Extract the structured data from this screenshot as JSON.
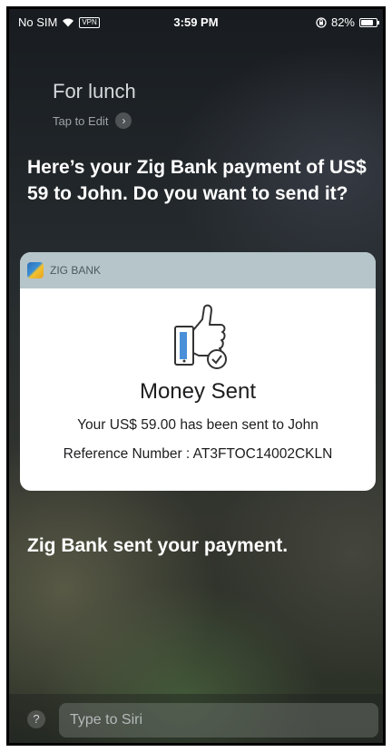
{
  "status_bar": {
    "carrier": "No SIM",
    "vpn_label": "VPN",
    "time": "3:59 PM",
    "battery_percent": "82%",
    "battery_level": 0.82
  },
  "siri": {
    "query": "For lunch",
    "tap_to_edit": "Tap to Edit",
    "response": "Here’s your Zig Bank payment of US$ 59 to John. Do you want to send it?",
    "final_response": "Zig Bank sent your payment."
  },
  "card": {
    "app_name": "ZIG BANK",
    "title": "Money Sent",
    "sent_line": "Your US$ 59.00 has been sent to John",
    "reference_line": "Reference Number : AT3FTOC14002CKLN"
  },
  "bottom": {
    "help_label": "?",
    "input_placeholder": "Type to Siri"
  }
}
